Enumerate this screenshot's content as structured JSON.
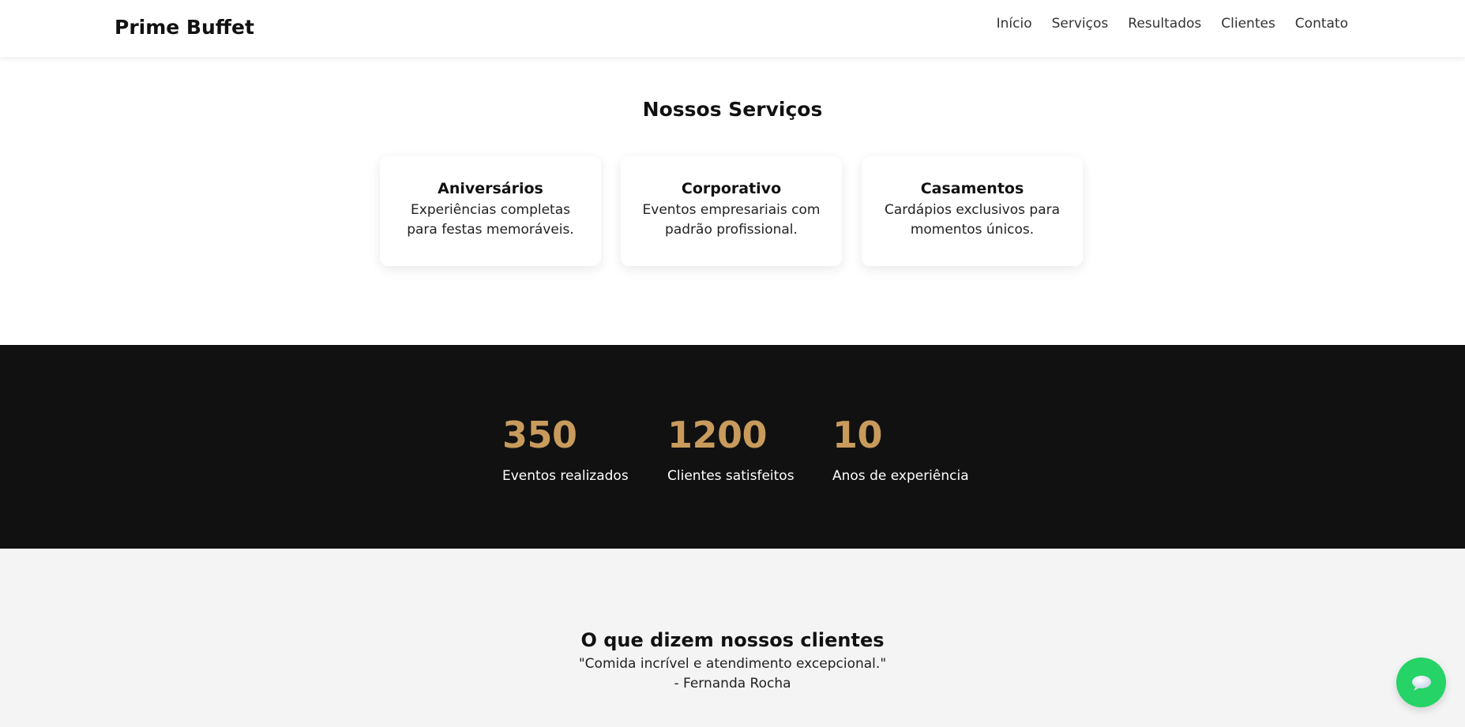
{
  "header": {
    "brand": "Prime Buffet",
    "nav": [
      "Início",
      "Serviços",
      "Resultados",
      "Clientes",
      "Contato"
    ]
  },
  "services": {
    "title": "Nossos Serviços",
    "cards": [
      {
        "title": "Aniversários",
        "desc": "Experiências completas para festas memoráveis."
      },
      {
        "title": "Corporativo",
        "desc": "Eventos empresariais com padrão profissional."
      },
      {
        "title": "Casamentos",
        "desc": "Cardápios exclusivos para momentos únicos."
      }
    ]
  },
  "stats": [
    {
      "value": "350",
      "label": "Eventos realizados"
    },
    {
      "value": "1200",
      "label": "Clientes satisfeitos"
    },
    {
      "value": "10",
      "label": "Anos de experiência"
    }
  ],
  "testimonials": {
    "title": "O que dizem nossos clientes",
    "quote": "\"Comida incrível e atendimento excepcional.\"",
    "author": "- Fernanda Rocha"
  },
  "chat_button": {
    "icon": "chat-bubble-icon",
    "color": "#25d366"
  },
  "colors": {
    "accent": "#c89b5c",
    "dark": "#111111",
    "light_bg": "#f4f4f4"
  }
}
